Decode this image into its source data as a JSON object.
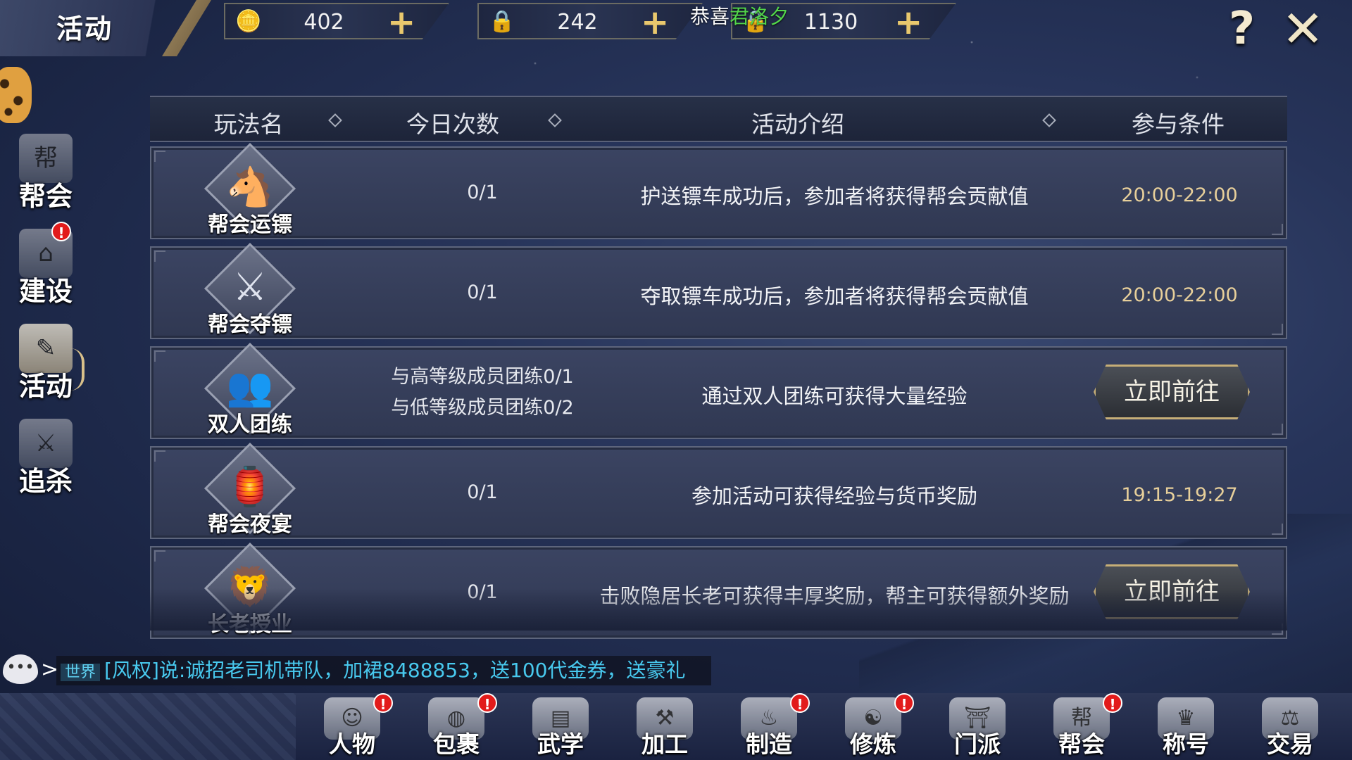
{
  "header": {
    "title": "活动",
    "currencies": [
      {
        "icon": "gold-ingot-icon",
        "value": "402"
      },
      {
        "icon": "locked-gold-icon",
        "value": "242"
      },
      {
        "icon": "locked-silver-icon",
        "value": "1130"
      }
    ],
    "plus": "+",
    "congrats_prefix": "恭喜",
    "congrats_name": "君洛夕",
    "help": "?",
    "close": "✕"
  },
  "sidebar": {
    "items": [
      {
        "label": "帮会",
        "icon": "guild-hall-icon",
        "glyph": "帮",
        "badge": false,
        "active": false
      },
      {
        "label": "建设",
        "icon": "building-icon",
        "glyph": "⌂",
        "badge": true,
        "active": false
      },
      {
        "label": "活动",
        "icon": "activity-quill-icon",
        "glyph": "✎",
        "badge": false,
        "active": true
      },
      {
        "label": "追杀",
        "icon": "hunt-icon",
        "glyph": "⚔",
        "badge": false,
        "active": false
      }
    ],
    "badge_text": "!"
  },
  "table": {
    "headers": [
      "玩法名",
      "今日次数",
      "活动介绍",
      "参与条件"
    ],
    "rows": [
      {
        "name": "帮会运镖",
        "icon": "escort-cart-icon",
        "glyph": "🐴",
        "count": [
          "0/1"
        ],
        "desc": "护送镖车成功后，参加者将获得帮会贡献值",
        "cond": "20:00-22:00",
        "button": null
      },
      {
        "name": "帮会夺镖",
        "icon": "rob-cart-icon",
        "glyph": "⚔",
        "count": [
          "0/1"
        ],
        "desc": "夺取镖车成功后，参加者将获得帮会贡献值",
        "cond": "20:00-22:00",
        "button": null
      },
      {
        "name": "双人团练",
        "icon": "duo-training-icon",
        "glyph": "👥",
        "count": [
          "与高等级成员团练0/1",
          "与低等级成员团练0/2"
        ],
        "desc": "通过双人团练可获得大量经验",
        "cond": "",
        "button": "立即前往"
      },
      {
        "name": "帮会夜宴",
        "icon": "night-banquet-icon",
        "glyph": "🏮",
        "count": [
          "0/1"
        ],
        "desc": "参加活动可获得经验与货币奖励",
        "cond": "19:15-19:27",
        "button": null
      },
      {
        "name": "长老授业",
        "icon": "elder-lion-icon",
        "glyph": "🦁",
        "count": [
          "0/1"
        ],
        "desc": "击败隐居长老可获得丰厚奖励，帮主可获得额外奖励",
        "cond": "",
        "button": "立即前往"
      }
    ]
  },
  "chat": {
    "channel": "世界",
    "message": "[风权]说:诚招老司机带队，加裙8488853，送100代金券，送豪礼",
    "icon": "chat-bubble-icon",
    "arrow": ">"
  },
  "bottom_nav": {
    "items": [
      {
        "label": "人物",
        "icon": "character-icon",
        "glyph": "☺",
        "badge": true
      },
      {
        "label": "包裹",
        "icon": "bag-icon",
        "glyph": "◍",
        "badge": true
      },
      {
        "label": "武学",
        "icon": "martial-book-icon",
        "glyph": "▤",
        "badge": false
      },
      {
        "label": "加工",
        "icon": "hammer-icon",
        "glyph": "⚒",
        "badge": false
      },
      {
        "label": "制造",
        "icon": "gourd-icon",
        "glyph": "♨",
        "badge": true
      },
      {
        "label": "修炼",
        "icon": "meditation-icon",
        "glyph": "☯",
        "badge": true
      },
      {
        "label": "门派",
        "icon": "sect-gate-icon",
        "glyph": "⛩",
        "badge": false
      },
      {
        "label": "帮会",
        "icon": "guild-icon",
        "glyph": "帮",
        "badge": true
      },
      {
        "label": "称号",
        "icon": "title-icon",
        "glyph": "♛",
        "badge": false
      },
      {
        "label": "交易",
        "icon": "trade-scale-icon",
        "glyph": "⚖",
        "badge": false
      }
    ]
  }
}
